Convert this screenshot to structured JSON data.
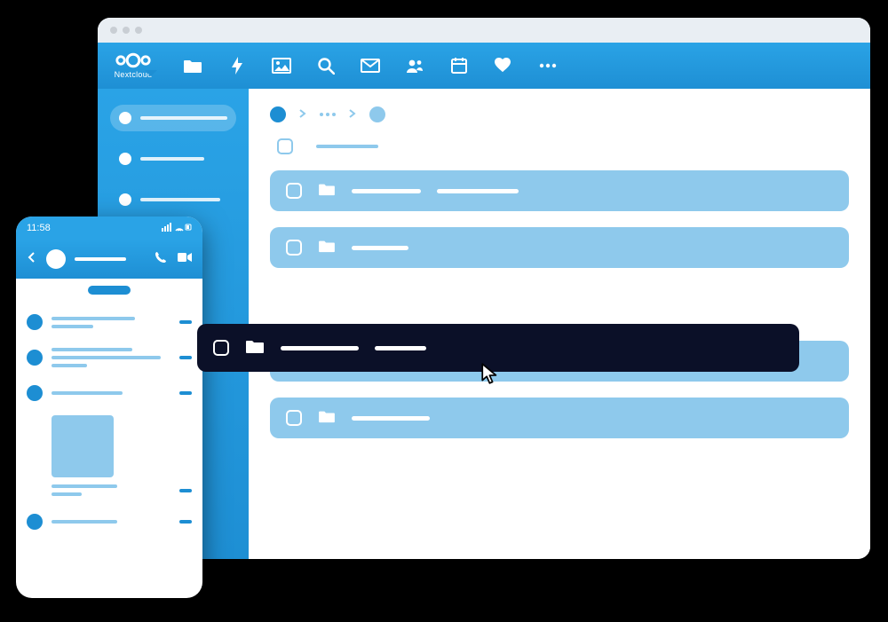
{
  "brand": {
    "name": "Nextcloud"
  },
  "topnav": {
    "items": [
      {
        "name": "files-icon",
        "active": true
      },
      {
        "name": "activity-icon",
        "active": false
      },
      {
        "name": "gallery-icon",
        "active": false
      },
      {
        "name": "search-icon",
        "active": false
      },
      {
        "name": "mail-icon",
        "active": false
      },
      {
        "name": "contacts-icon",
        "active": false
      },
      {
        "name": "calendar-icon",
        "active": false
      },
      {
        "name": "favorites-icon",
        "active": false
      },
      {
        "name": "more-icon",
        "active": false
      }
    ]
  },
  "mobile": {
    "time": "11:58",
    "head_icons": [
      "phone-icon",
      "video-icon"
    ]
  },
  "colors": {
    "brand": "#1e8fd4",
    "brand_light": "#8ec9ec",
    "selected_bg": "#0b1028"
  }
}
